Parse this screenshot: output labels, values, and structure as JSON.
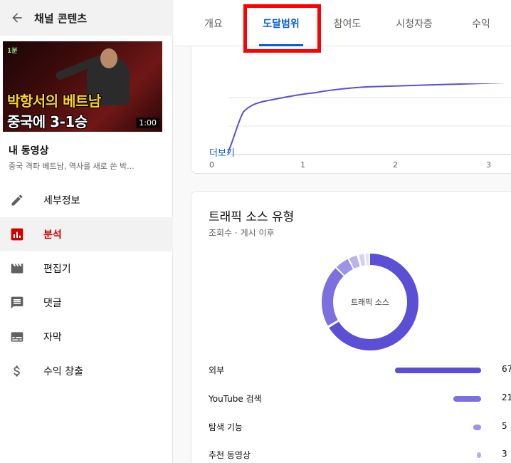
{
  "sidebar": {
    "title": "채널 콘텐츠",
    "thumbnail": {
      "watermark": "1분",
      "headline_top": "박항서의 베트남",
      "headline_bottom": "중국에 3-1승",
      "duration": "1:00"
    },
    "my_video_label": "내 동영상",
    "video_title": "중국 격파 베트남, 역사를 새로 쓴 박...",
    "nav": [
      {
        "label": "세부정보",
        "icon": "pencil-icon",
        "active": false
      },
      {
        "label": "분석",
        "icon": "analytics-icon",
        "active": true
      },
      {
        "label": "편집기",
        "icon": "clapperboard-icon",
        "active": false
      },
      {
        "label": "댓글",
        "icon": "comment-icon",
        "active": false
      },
      {
        "label": "자막",
        "icon": "subtitles-icon",
        "active": false
      },
      {
        "label": "수익 창출",
        "icon": "dollar-icon",
        "active": false
      }
    ]
  },
  "tabs": [
    {
      "label": "개요",
      "active": false
    },
    {
      "label": "도달범위",
      "active": true
    },
    {
      "label": "참여도",
      "active": false
    },
    {
      "label": "시청자층",
      "active": false
    },
    {
      "label": "수익",
      "active": false
    }
  ],
  "reach_card": {
    "x_ticks": [
      "0",
      "1",
      "2",
      "3"
    ],
    "see_more": "더보기"
  },
  "traffic_card": {
    "title": "트래픽 소스 유형",
    "subtitle": "조회수 · 게시 이후",
    "donut_label": "트래픽 소스",
    "sources": [
      {
        "name": "외부",
        "value": "67",
        "color": "#5b4fd6"
      },
      {
        "name": "YouTube 검색",
        "value": "21",
        "color": "#7b70de"
      },
      {
        "name": "탐색 기능",
        "value": "5",
        "color": "#9c94e6"
      },
      {
        "name": "추천 동영상",
        "value": "3",
        "color": "#b8b2ee"
      }
    ]
  },
  "colors": {
    "accent_blue": "#065fd4",
    "active_red": "#cc0000",
    "highlight_red": "#ff0000",
    "chart_purple": "#5b4fd6"
  }
}
